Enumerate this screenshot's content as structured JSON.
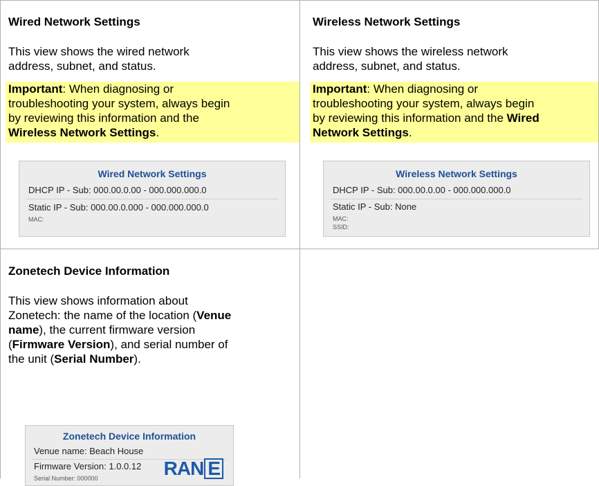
{
  "wired": {
    "heading": "Wired Network Settings",
    "para_line1": "This view shows the wired network",
    "para_line2": "address, subnet, and status.",
    "important_label": "Important",
    "important_line1_rest": ": When diagnosing or",
    "important_line2": "troubleshooting your system, always begin",
    "important_line3": "by reviewing this information and the",
    "important_bold": "Wireless Network Settings",
    "important_end": ".",
    "panel": {
      "title": "Wired Network Settings",
      "dhcp": "DHCP  IP - Sub: 000.00.0.00 - 000.000.000.0",
      "static": "Static  IP - Sub: 000.00.0.000 - 000.000.000.0",
      "mac": "MAC:"
    }
  },
  "wireless": {
    "heading": "Wireless Network Settings",
    "para_line1": "This view shows the wireless network",
    "para_line2": "address, subnet, and status.",
    "important_label": "Important",
    "important_line1_rest": ": When diagnosing or",
    "important_line2": "troubleshooting your system, always begin",
    "important_line3_a": "by reviewing this information and the ",
    "important_line3_bold": "Wired",
    "important_line4_bold": "Network Settings",
    "important_end": ".",
    "panel": {
      "title": "Wireless Network Settings",
      "dhcp": "DHCP  IP - Sub: 000.00.0.00 - 000.000.000.0",
      "static": "Static  IP - Sub: None",
      "mac": "MAC:",
      "ssid": "SSID:"
    }
  },
  "device": {
    "heading": "Zonetech Device Information",
    "line1": "This view shows information about",
    "line2_a": "Zonetech: the name of the location (",
    "line2_bold": "Venue",
    "line3_bold": "name",
    "line3_b": "), the current firmware version",
    "line4_a": "(",
    "line4_bold": "Firmware Version",
    "line4_b": "), and serial number of",
    "line5_a": "the unit (",
    "line5_bold": "Serial Number",
    "line5_b": ").",
    "panel": {
      "title": "Zonetech Device Information",
      "venue": "Venue name: Beach House",
      "firmware": "Firmware Version: 1.0.0.12",
      "serial": "Serial Number: 000000",
      "logo_text": "RAN",
      "logo_box": "E"
    }
  }
}
